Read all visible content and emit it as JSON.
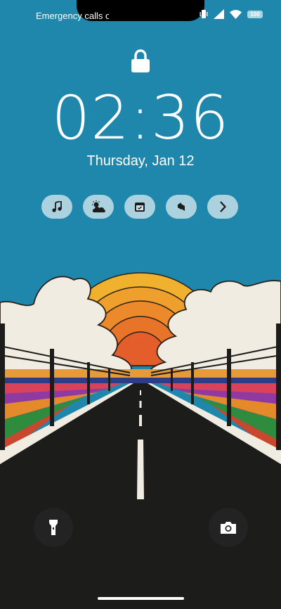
{
  "status_bar": {
    "carrier_text": "Emergency calls only",
    "battery_level": "100",
    "icons": [
      "vibrate-icon",
      "signal-icon",
      "wifi-icon",
      "battery-icon"
    ]
  },
  "lock_screen": {
    "lock_icon": "lock-icon",
    "time": "02:36",
    "date": "Thursday, Jan 12"
  },
  "shortcuts": [
    {
      "icon": "music-icon"
    },
    {
      "icon": "weather-icon"
    },
    {
      "icon": "calendar-icon"
    },
    {
      "icon": "app-icon"
    },
    {
      "icon": "chevron-right-icon"
    }
  ],
  "bottom_actions": {
    "left_icon": "flashlight-icon",
    "right_icon": "camera-icon"
  },
  "colors": {
    "sky": "#1f87ab",
    "road": "#1c1c1a",
    "sun_yellow": "#f0b22e",
    "sun_orange": "#e8782a",
    "cloud": "#f1ece1"
  }
}
